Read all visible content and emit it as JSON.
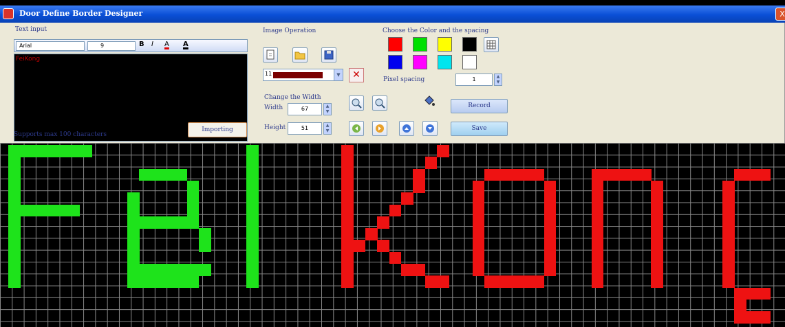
{
  "window": {
    "title": "Door Define Border Designer",
    "close_label": "X"
  },
  "text_panel": {
    "label": "Text input",
    "font": "Arial",
    "size": "9",
    "bold_label": "B",
    "italic_label": "I",
    "font_color_label": "A",
    "highlight_label": "A",
    "content": "FeiKong",
    "support_text": "Supports max 100 characters",
    "import_label": "Importing"
  },
  "image_panel": {
    "label": "Image Operation",
    "color_combo_label": "11",
    "change_width_label": "Change the Width",
    "width_label": "Width",
    "width_value": "67",
    "height_label": "Height",
    "height_value": "51"
  },
  "color_panel": {
    "label": "Choose the Color and the spacing",
    "colors": [
      "#ff0000",
      "#00e000",
      "#ffff00",
      "#000000",
      "#0000ee",
      "#ff00ff",
      "#00e5ee",
      "#ffffff"
    ],
    "pixel_spacing_label": "Pixel spacing",
    "pixel_spacing_value": "1"
  },
  "buttons": {
    "record": "Record",
    "save": "Save"
  },
  "icons": {
    "new": "new-file-icon",
    "open": "open-folder-icon",
    "save": "save-disk-icon",
    "zoom_in": "zoom-in-icon",
    "zoom_out": "zoom-out-icon",
    "paint": "paint-bucket-icon",
    "left": "arrow-left-icon",
    "right": "arrow-right-icon",
    "up": "arrow-up-icon",
    "down": "arrow-down-icon",
    "delete": "delete-x-icon",
    "grid": "grid-settings-icon"
  },
  "canvas": {
    "grid_color": "#8a8a8a",
    "green": "#1ee31b",
    "red": "#ee1212",
    "green_cells": [
      [
        1,
        1
      ],
      [
        1,
        2
      ],
      [
        1,
        3
      ],
      [
        1,
        4
      ],
      [
        1,
        5
      ],
      [
        1,
        6
      ],
      [
        1,
        7
      ],
      [
        1,
        8
      ],
      [
        1,
        9
      ],
      [
        1,
        10
      ],
      [
        1,
        11
      ],
      [
        1,
        12
      ],
      [
        2,
        1
      ],
      [
        3,
        1
      ],
      [
        4,
        1
      ],
      [
        5,
        1
      ],
      [
        6,
        1
      ],
      [
        7,
        1
      ],
      [
        2,
        6
      ],
      [
        3,
        6
      ],
      [
        4,
        6
      ],
      [
        5,
        6
      ],
      [
        6,
        6
      ],
      [
        11,
        5
      ],
      [
        11,
        6
      ],
      [
        11,
        7
      ],
      [
        11,
        8
      ],
      [
        11,
        9
      ],
      [
        11,
        10
      ],
      [
        11,
        11
      ],
      [
        11,
        12
      ],
      [
        12,
        3
      ],
      [
        13,
        3
      ],
      [
        14,
        3
      ],
      [
        15,
        3
      ],
      [
        16,
        4
      ],
      [
        16,
        5
      ],
      [
        16,
        6
      ],
      [
        16,
        7
      ],
      [
        17,
        8
      ],
      [
        17,
        9
      ],
      [
        12,
        7
      ],
      [
        13,
        7
      ],
      [
        14,
        7
      ],
      [
        15,
        7
      ],
      [
        12,
        11
      ],
      [
        13,
        11
      ],
      [
        14,
        11
      ],
      [
        15,
        11
      ],
      [
        16,
        11
      ],
      [
        17,
        11
      ],
      [
        16,
        12
      ],
      [
        12,
        12
      ],
      [
        13,
        12
      ],
      [
        14,
        12
      ],
      [
        15,
        12
      ],
      [
        21,
        1
      ],
      [
        21,
        2
      ],
      [
        21,
        3
      ],
      [
        21,
        4
      ],
      [
        21,
        5
      ],
      [
        21,
        6
      ],
      [
        21,
        7
      ],
      [
        21,
        8
      ],
      [
        21,
        9
      ],
      [
        21,
        10
      ],
      [
        21,
        11
      ],
      [
        21,
        12
      ]
    ],
    "red_cells": [
      [
        29,
        1
      ],
      [
        29,
        2
      ],
      [
        29,
        3
      ],
      [
        29,
        4
      ],
      [
        29,
        5
      ],
      [
        29,
        6
      ],
      [
        29,
        7
      ],
      [
        29,
        8
      ],
      [
        29,
        9
      ],
      [
        29,
        10
      ],
      [
        29,
        11
      ],
      [
        29,
        12
      ],
      [
        37,
        1
      ],
      [
        36,
        2
      ],
      [
        35,
        3
      ],
      [
        35,
        4
      ],
      [
        34,
        5
      ],
      [
        33,
        6
      ],
      [
        32,
        7
      ],
      [
        31,
        8
      ],
      [
        30,
        9
      ],
      [
        32,
        9
      ],
      [
        33,
        10
      ],
      [
        34,
        11
      ],
      [
        35,
        11
      ],
      [
        36,
        12
      ],
      [
        37,
        12
      ],
      [
        41,
        3
      ],
      [
        42,
        3
      ],
      [
        43,
        3
      ],
      [
        44,
        3
      ],
      [
        45,
        3
      ],
      [
        40,
        4
      ],
      [
        40,
        5
      ],
      [
        40,
        6
      ],
      [
        40,
        7
      ],
      [
        40,
        8
      ],
      [
        40,
        9
      ],
      [
        40,
        10
      ],
      [
        40,
        11
      ],
      [
        46,
        4
      ],
      [
        46,
        5
      ],
      [
        46,
        6
      ],
      [
        46,
        7
      ],
      [
        46,
        8
      ],
      [
        46,
        9
      ],
      [
        46,
        10
      ],
      [
        46,
        11
      ],
      [
        41,
        12
      ],
      [
        42,
        12
      ],
      [
        43,
        12
      ],
      [
        44,
        12
      ],
      [
        45,
        12
      ],
      [
        50,
        3
      ],
      [
        50,
        4
      ],
      [
        50,
        5
      ],
      [
        50,
        6
      ],
      [
        50,
        7
      ],
      [
        50,
        8
      ],
      [
        50,
        9
      ],
      [
        50,
        10
      ],
      [
        50,
        11
      ],
      [
        50,
        12
      ],
      [
        51,
        3
      ],
      [
        52,
        3
      ],
      [
        53,
        3
      ],
      [
        54,
        3
      ],
      [
        55,
        4
      ],
      [
        55,
        5
      ],
      [
        55,
        6
      ],
      [
        55,
        7
      ],
      [
        55,
        8
      ],
      [
        55,
        9
      ],
      [
        55,
        10
      ],
      [
        55,
        11
      ],
      [
        55,
        12
      ],
      [
        62,
        3
      ],
      [
        63,
        3
      ],
      [
        64,
        3
      ],
      [
        61,
        4
      ],
      [
        61,
        5
      ],
      [
        61,
        6
      ],
      [
        61,
        7
      ],
      [
        61,
        8
      ],
      [
        61,
        9
      ],
      [
        61,
        10
      ],
      [
        61,
        11
      ],
      [
        61,
        12
      ],
      [
        62,
        13
      ],
      [
        63,
        13
      ],
      [
        64,
        13
      ],
      [
        62,
        15
      ],
      [
        63,
        15
      ],
      [
        64,
        15
      ],
      [
        62,
        14
      ]
    ]
  }
}
